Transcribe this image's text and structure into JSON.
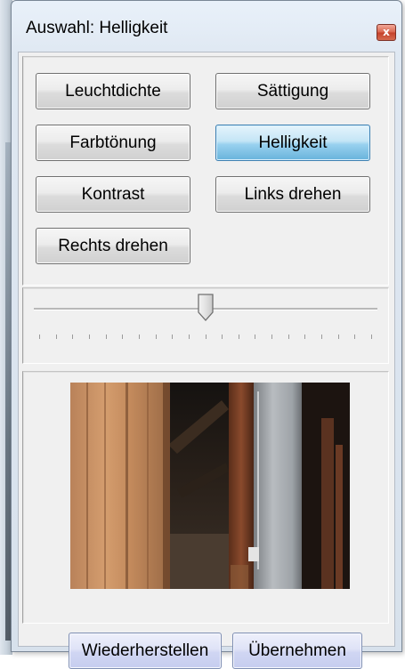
{
  "window": {
    "title": "Auswahl: Helligkeit",
    "close_symbol": "x"
  },
  "adjustments": {
    "buttons": [
      {
        "label": "Leuchtdichte",
        "active": false
      },
      {
        "label": "Sättigung",
        "active": false
      },
      {
        "label": "Farbtönung",
        "active": false
      },
      {
        "label": "Helligkeit",
        "active": true
      },
      {
        "label": "Kontrast",
        "active": false
      },
      {
        "label": "Links drehen",
        "active": false
      },
      {
        "label": "Rechts drehen",
        "active": false
      }
    ]
  },
  "slider": {
    "value_fraction": 0.5,
    "tick_count": 21
  },
  "preview": {
    "image": "attic-wooden-beams-photo"
  },
  "footer": {
    "reset_label": "Wiederherstellen",
    "apply_label": "Übernehmen"
  },
  "colors": {
    "active_button": "#98d1ef",
    "close_button": "#d9664f",
    "panel_bg": "#f0f0f0"
  }
}
